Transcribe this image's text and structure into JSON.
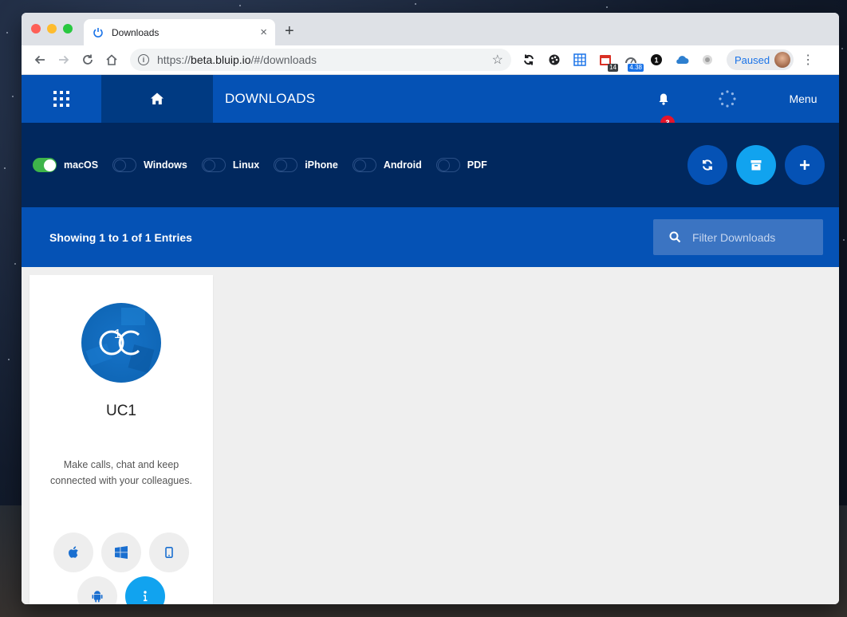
{
  "browser": {
    "tab_title": "Downloads",
    "tab_close": "×",
    "new_tab": "+",
    "url_scheme": "https://",
    "url_host": "beta.bluip.io",
    "url_path": "/#/downloads",
    "extensions": [
      {
        "name": "sync-icon"
      },
      {
        "name": "palette-icon"
      },
      {
        "name": "grid-icon"
      },
      {
        "name": "calendar-icon",
        "badge": "14"
      },
      {
        "name": "speed-icon",
        "badge": "4.38"
      },
      {
        "name": "one-password-icon",
        "glyph": "1"
      },
      {
        "name": "cloud-icon"
      },
      {
        "name": "circle-icon"
      }
    ],
    "profile_label": "Paused"
  },
  "header": {
    "title": "DOWNLOADS",
    "notification_count": "3",
    "menu_label": "Menu",
    "accent": "#0552b5",
    "dark": "#003a82"
  },
  "filters": [
    {
      "label": "macOS",
      "on": true
    },
    {
      "label": "Windows",
      "on": false
    },
    {
      "label": "Linux",
      "on": false
    },
    {
      "label": "iPhone",
      "on": false
    },
    {
      "label": "Android",
      "on": false
    },
    {
      "label": "PDF",
      "on": false
    }
  ],
  "actions": {
    "refresh": "refresh-icon",
    "archive": "archive-icon",
    "add": "plus-icon"
  },
  "entries": {
    "summary": "Showing 1 to 1 of 1 Entries",
    "filter_placeholder": "Filter Downloads"
  },
  "apps": [
    {
      "name": "UC1",
      "description": "Make calls, chat and keep connected with your colleagues.",
      "platforms": [
        "apple-icon",
        "windows-icon",
        "mobile-icon",
        "android-icon",
        "info-icon"
      ]
    }
  ]
}
